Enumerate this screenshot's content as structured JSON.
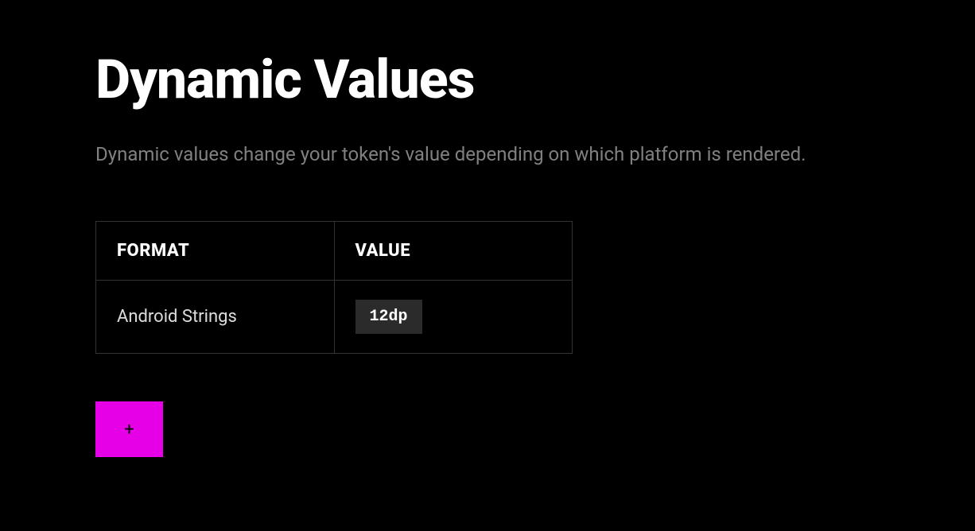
{
  "title": "Dynamic Values",
  "subtitle": "Dynamic values change your token's value depending on which platform is rendered.",
  "table": {
    "headers": {
      "format": "FORMAT",
      "value": "VALUE"
    },
    "rows": [
      {
        "format": "Android Strings",
        "value": "12dp"
      }
    ]
  },
  "buttons": {
    "add_label": "+"
  },
  "colors": {
    "accent": "#e500e5",
    "background": "#000000",
    "text_muted": "#808080",
    "border": "#333333",
    "badge_bg": "#2b2b2b"
  }
}
